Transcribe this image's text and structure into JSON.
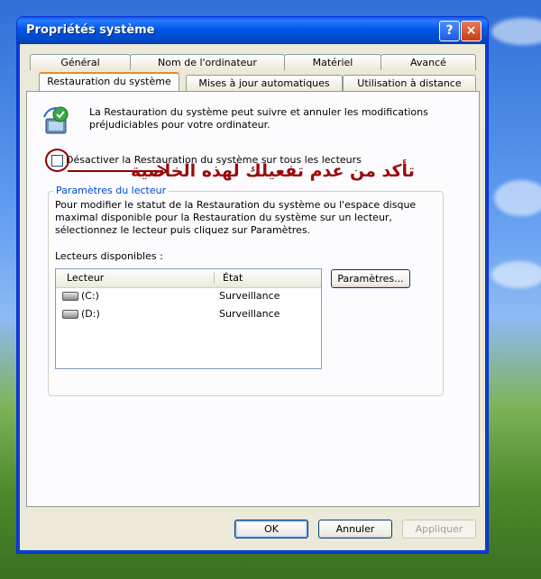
{
  "window": {
    "title": "Propriétés système",
    "help_label": "?",
    "close_label": "×"
  },
  "tabs_top": [
    {
      "label": "Général"
    },
    {
      "label": "Nom de l'ordinateur"
    },
    {
      "label": "Matériel"
    },
    {
      "label": "Avancé"
    }
  ],
  "tabs_bottom": [
    {
      "label": "Restauration du système",
      "active": true
    },
    {
      "label": "Mises à jour automatiques"
    },
    {
      "label": "Utilisation à distance"
    }
  ],
  "intro_text": "La Restauration du système peut suivre et annuler les modifications préjudiciables pour votre ordinateur.",
  "disable_checkbox": {
    "label": "Désactiver la Restauration du système sur tous les lecteurs",
    "checked": false
  },
  "annotation": {
    "text": "تأكد من عدم تفعيلك لهذه الخاصية",
    "color": "#9a0a0a"
  },
  "group": {
    "title": "Paramètres du lecteur",
    "description": "Pour modifier le statut de la Restauration du système ou l'espace disque maximal disponible pour la Restauration du système sur un lecteur, sélectionnez le lecteur puis cliquez sur Paramètres.",
    "drives_label": "Lecteurs disponibles :",
    "columns": {
      "drive": "Lecteur",
      "state": "État"
    },
    "drives": [
      {
        "name": "(C:)",
        "state": "Surveillance"
      },
      {
        "name": "(D:)",
        "state": "Surveillance"
      }
    ],
    "settings_button": "Paramètres..."
  },
  "footer": {
    "ok": "OK",
    "cancel": "Annuler",
    "apply": "Appliquer"
  },
  "colors": {
    "title_bar": "#0058e6",
    "group_title": "#0046d5",
    "annotation": "#9a0a0a"
  }
}
